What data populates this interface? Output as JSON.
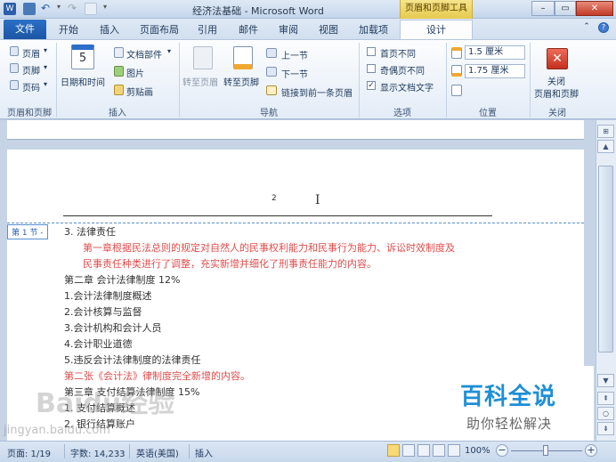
{
  "window": {
    "title": "经济法基础 - Microsoft Word",
    "context_group": "页眉和页脚工具",
    "min": "–",
    "restore": "▭",
    "close": "✕"
  },
  "tabs": {
    "file": "文件",
    "items": [
      "开始",
      "插入",
      "页面布局",
      "引用",
      "邮件",
      "审阅",
      "视图",
      "加载项"
    ],
    "active": "设计"
  },
  "ribbon": {
    "header_footer": {
      "header": "页眉",
      "footer": "页脚",
      "page_number": "页码",
      "label": "页眉和页脚"
    },
    "insert": {
      "datetime": "日期和时间",
      "doc_parts": "文档部件",
      "picture": "图片",
      "clipart": "剪贴画",
      "label": "插入",
      "calendar_num": "5"
    },
    "navigation": {
      "goto_header": "转至页眉",
      "goto_footer": "转至页脚",
      "prev": "上一节",
      "next": "下一节",
      "link_prev": "链接到前一条页眉",
      "label": "导航"
    },
    "options": {
      "diff_first": "首页不同",
      "diff_odd_even": "奇偶页不同",
      "show_text": "显示文档文字",
      "label": "选项"
    },
    "position": {
      "header_pos": "1.5 厘米",
      "footer_pos": "1.75 厘米",
      "label": "位置"
    },
    "close": {
      "button": "关闭\n页眉和页脚",
      "line1": "关闭",
      "line2": "页眉和页脚",
      "label": "关闭"
    }
  },
  "document": {
    "page_number": "2",
    "section_tag": "第 1 节 -",
    "lines": [
      {
        "text": "3.  法律责任",
        "color": "black"
      },
      {
        "text": "第一章根据民法总则的规定对自然人的民事权利能力和民事行为能力、诉讼时效制度及",
        "color": "red"
      },
      {
        "text": "民事责任种类进行了调整，充实新增并细化了刑事责任能力的内容。",
        "color": "red"
      },
      {
        "text": "第二章  会计法律制度  12%",
        "color": "black"
      },
      {
        "text": "1.会计法律制度概述",
        "color": "black"
      },
      {
        "text": "2.会计核算与监督",
        "color": "black"
      },
      {
        "text": "3.会计机构和会计人员",
        "color": "black"
      },
      {
        "text": "4.会计职业道德",
        "color": "black"
      },
      {
        "text": "5.违反会计法律制度的法律责任",
        "color": "black"
      },
      {
        "text": "第二张《会计法》律制度完全新增的内容。",
        "color": "red"
      },
      {
        "text": "第三章  支付结算法律制度  15%",
        "color": "black"
      },
      {
        "text": "1.  支付结算概述",
        "color": "black"
      },
      {
        "text": "2.  银行结算账户",
        "color": "black"
      }
    ]
  },
  "status": {
    "page": "页面: 1/19",
    "words": "字数: 14,233",
    "lang": "英语(美国)",
    "mode": "插入",
    "zoom": "100%",
    "minus": "−",
    "plus": "+"
  },
  "watermark": {
    "baike_title": "百科全说",
    "baike_sub": "助你轻松解决",
    "baidu": "Baidu经验",
    "baidu_url": "jingyan.baidu.com"
  },
  "colors": {
    "accent": "#2b6fc6",
    "red_text": "#e24c4c",
    "context_tab": "#f0d66a",
    "baike_blue": "#1f8fd6"
  }
}
